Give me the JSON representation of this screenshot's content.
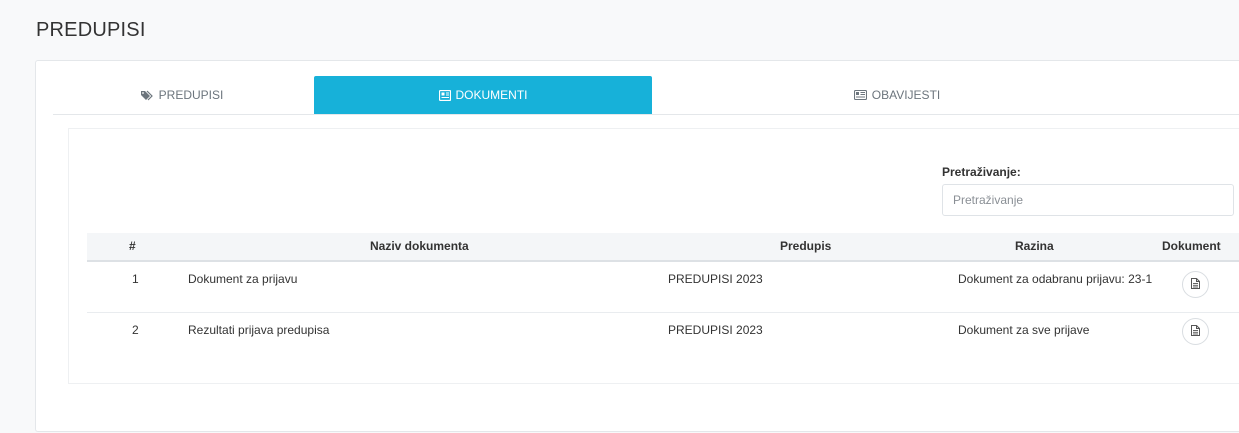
{
  "page": {
    "title": "PREDUPISI"
  },
  "tabs": [
    {
      "label": "PREDUPISI",
      "icon": "tags-icon",
      "active": false
    },
    {
      "label": "DOKUMENTI",
      "icon": "document-icon",
      "active": true
    },
    {
      "label": "OBAVIJESTI",
      "icon": "newspaper-icon",
      "active": false
    }
  ],
  "search": {
    "label": "Pretraživanje:",
    "placeholder": "Pretraživanje",
    "value": ""
  },
  "table": {
    "columns": [
      "#",
      "Naziv dokumenta",
      "Predupis",
      "Razina",
      "Dokument"
    ],
    "rows": [
      {
        "num": "1",
        "naziv": "Dokument za prijavu",
        "predupis": "PREDUPISI 2023",
        "razina": "Dokument za odabranu prijavu: 23-1",
        "dokument_icon": "file-icon"
      },
      {
        "num": "2",
        "naziv": "Rezultati prijava predupisa",
        "predupis": "PREDUPISI 2023",
        "razina": "Dokument za sve prijave",
        "dokument_icon": "file-icon"
      }
    ]
  },
  "colors": {
    "accent": "#17b1d9",
    "text": "#333333",
    "muted": "#6c757d"
  }
}
